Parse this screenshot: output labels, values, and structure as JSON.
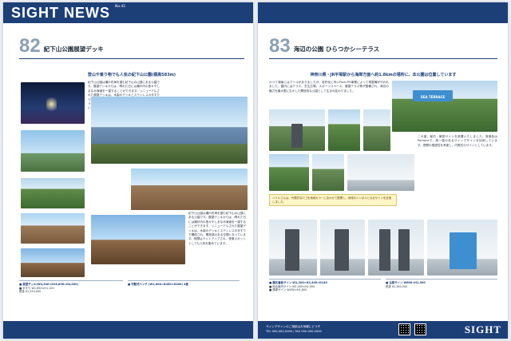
{
  "left_page": {
    "masthead": "SIGHT NEWS",
    "vol": "No.41",
    "number": "82",
    "title": "紀下山公園展望デッキ",
    "subtitle": "登山や乗り物でも人気の紀下山公園(標高583m)",
    "body": "紀下山公園は瀬戸内海を望む紀下山の山頂にある公園です。展望デッキからは、晴れた日には瀬戸内の島々やしまなみ海道を一望することができます。リニューアルされた展望デッキは、木製のデッキとステンレスの手すりで構成され、開放感のある空間となっています。夜間はライトアップされ、夜景スポットとしても人気を集めています。",
    "spec_1": "■ 展望デッキ(W4,546×D16,896×H4,000)",
    "spec_2": "■ 手すり W1,650×H1,100",
    "spec_3": "■ 可動式ベンチ (W1,800×D450×H400) 4基",
    "price": "税抜 ¥1,250,000"
  },
  "right_page": {
    "number": "83",
    "title": "海辺の公園 ひらつかシーテラス",
    "subtitle": "神奈川県・JR平塚駅から海岸方面へ約1.8kmの場所に、本公園は位置しています",
    "body": "かつて湘南にはプールがありましたが、老朽化に伴いPark-PFI事業によって再整備が行われました。園内にはテラス、芝生広場、スポーツスペース、展望テラス等が整備され、海辺の魅力を最大限に生かした開放的な公園として生まれ変わりました。",
    "body_2": "この度、案内・解説サインを設置いたしました。背景色はPantoneで、統一感のあるサインデザインを採用しています。夜間の視認性を考慮し、内照式のサインとしています。",
    "callout": "ハミルさんは、代表的なロゴを地域カラーに合わせて配置し、地域のシンボルとなるサインを目指しました。",
    "sign_label": "SEA TERRACE",
    "spec_1": "■ 園名看板サイン W1,200×H2,400×D140",
    "spec_2": "■ 総合案内サイン W1,000×H2,000",
    "spec_3": "■ 誘導サイン W450×H1,800",
    "spec_4": "■ 注意サイン W600×H1,500",
    "price": "税抜 ¥2,380,000"
  },
  "footer": {
    "company": "SIGHT",
    "tagline": "サインデザインのご相談はお気軽にどうぞ",
    "contact": "TEL 000-000-0000 / FAX 000-000-0000"
  },
  "colors": {
    "navy": "#1c3f78",
    "grey_num": "#8aa0b3"
  }
}
